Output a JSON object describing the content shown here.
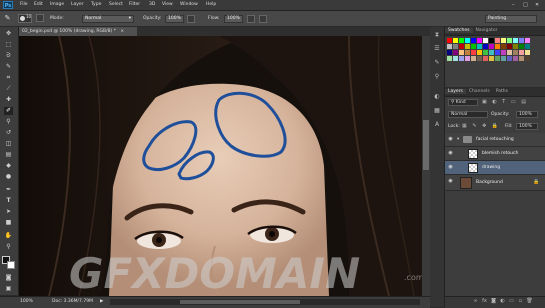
{
  "app": {
    "logo": "Ps"
  },
  "menu": [
    "File",
    "Edit",
    "Image",
    "Layer",
    "Type",
    "Select",
    "Filter",
    "3D",
    "View",
    "Window",
    "Help"
  ],
  "window_controls": {
    "minimize": "–",
    "maximize": "□",
    "close": "✕"
  },
  "options_bar": {
    "brush_size": "10",
    "mode_label": "Mode:",
    "mode_value": "Normal",
    "opacity_label": "Opacity:",
    "opacity_value": "100%",
    "flow_label": "Flow:",
    "flow_value": "100%",
    "workspace_value": "Painting"
  },
  "document": {
    "tab_title": "02_begin.psd @ 100% (drawing, RGB/8) *",
    "close_glyph": "×",
    "zoom": "100%",
    "doc_info": "Doc: 3.36M/7.79M",
    "watermark": "GFXDOMAIN",
    "watermark_sub": ".com"
  },
  "swatches_panel": {
    "tabs": [
      "Swatches",
      "Navigator"
    ],
    "colors": [
      "#ff0000",
      "#ffff00",
      "#00ff00",
      "#00ffff",
      "#0000ff",
      "#ff00ff",
      "#ffffff",
      "#000000",
      "#ff8080",
      "#ffff80",
      "#80ff80",
      "#80ffff",
      "#8080ff",
      "#ff80ff",
      "#c0c0c0",
      "#808080",
      "#c00000",
      "#c0c000",
      "#00c000",
      "#00c0c0",
      "#0000c0",
      "#c000c0",
      "#ff8000",
      "#804000",
      "#800000",
      "#808000",
      "#008000",
      "#008080",
      "#000080",
      "#800080",
      "#ffc080",
      "#c08040",
      "#ff4040",
      "#ffc000",
      "#40c040",
      "#40c0c0",
      "#4040ff",
      "#c040c0",
      "#e0c0a0",
      "#a08060",
      "#f4a0a0",
      "#f0e090",
      "#a0e0a0",
      "#a0e0e0",
      "#a0a0f0",
      "#e0a0e0",
      "#d0b090",
      "#706050",
      "#e06060",
      "#e0c040",
      "#60a060",
      "#60a0a0",
      "#6060c0",
      "#a060a0",
      "#b09070",
      "#504030"
    ]
  },
  "layers_panel": {
    "tabs": [
      "Layers",
      "Channels",
      "Paths"
    ],
    "kind_label": "Kind",
    "blend_mode": "Normal",
    "opacity_label": "Opacity:",
    "opacity_value": "100%",
    "lock_label": "Lock:",
    "fill_label": "Fill:",
    "fill_value": "100%",
    "layers": [
      {
        "name": "facial retouching",
        "type": "group"
      },
      {
        "name": "blemish retouch",
        "type": "layer"
      },
      {
        "name": "drawing",
        "type": "layer"
      },
      {
        "name": "Background",
        "type": "background"
      }
    ]
  },
  "accent_color": "#1f4f9a"
}
